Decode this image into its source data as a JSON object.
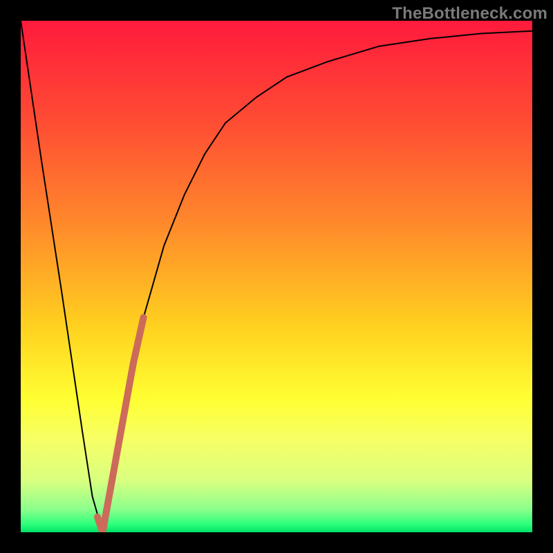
{
  "watermark": {
    "text": "TheBottleneck.com"
  },
  "chart_data": {
    "type": "line",
    "title": "",
    "xlabel": "",
    "ylabel": "",
    "xlim": [
      0,
      100
    ],
    "ylim": [
      0,
      100
    ],
    "grid": false,
    "legend": false,
    "background_gradient_stops": [
      {
        "pos": 0.0,
        "color": "#ff1a3c"
      },
      {
        "pos": 0.2,
        "color": "#ff4d33"
      },
      {
        "pos": 0.4,
        "color": "#ff8a2b"
      },
      {
        "pos": 0.6,
        "color": "#ffd21f"
      },
      {
        "pos": 0.74,
        "color": "#ffff33"
      },
      {
        "pos": 0.82,
        "color": "#f7ff66"
      },
      {
        "pos": 0.9,
        "color": "#d8ff80"
      },
      {
        "pos": 0.955,
        "color": "#8cff8c"
      },
      {
        "pos": 0.985,
        "color": "#2bff7a"
      },
      {
        "pos": 1.0,
        "color": "#00e067"
      }
    ],
    "series": [
      {
        "name": "bottleneck-curve",
        "color": "#000000",
        "width": 2,
        "x": [
          0,
          4,
          8,
          12,
          14,
          16,
          18,
          20,
          22,
          24,
          28,
          32,
          36,
          40,
          46,
          52,
          60,
          70,
          80,
          90,
          100
        ],
        "values": [
          100,
          73,
          47,
          20,
          7,
          0,
          11,
          22,
          33,
          42,
          56,
          66,
          74,
          80,
          85,
          89,
          92,
          95,
          96.5,
          97.5,
          98
        ]
      },
      {
        "name": "highlight-segment",
        "color": "#cc6b5a",
        "width": 10,
        "linecap": "round",
        "x": [
          15,
          16,
          18,
          20,
          22,
          24
        ],
        "values": [
          3,
          0,
          11,
          22,
          33,
          42
        ]
      }
    ]
  }
}
